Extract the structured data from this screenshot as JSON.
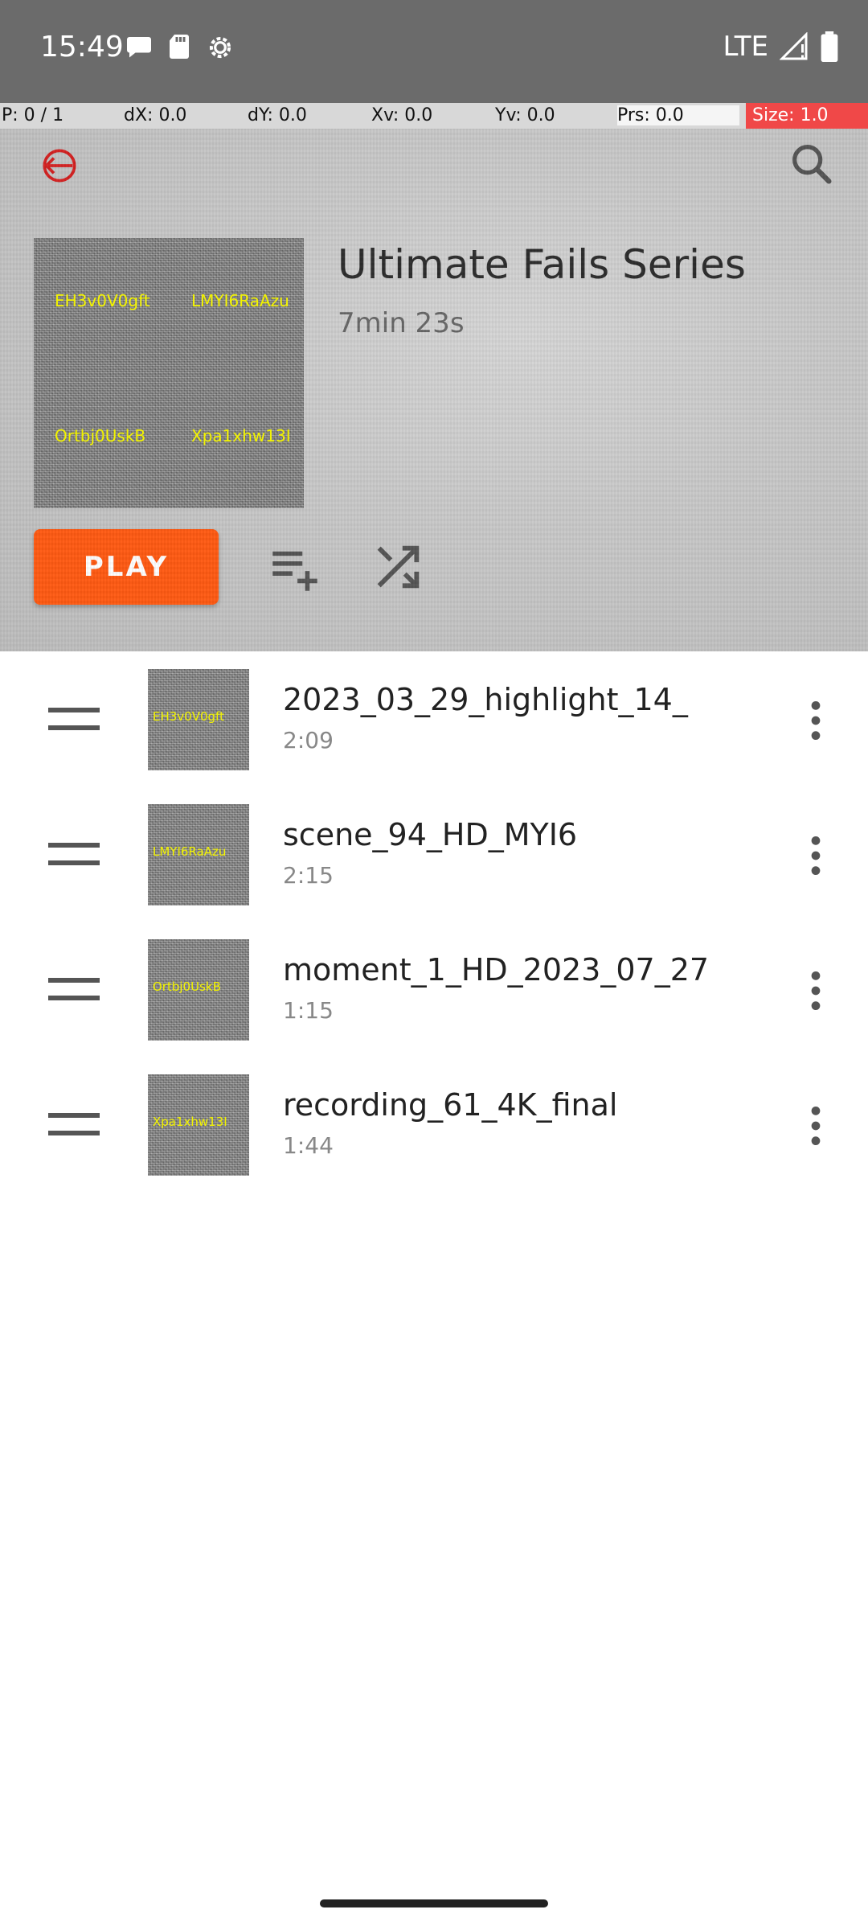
{
  "status_bar": {
    "time": "15:49",
    "network": "LTE"
  },
  "pointer_bar": {
    "p": "P: 0 / 1",
    "dx": "dX: 0.0",
    "dy": "dY: 0.0",
    "xv": "Xv: 0.0",
    "yv": "Yv: 0.0",
    "prs": "Prs: 0.0",
    "size": "Size: 1.0"
  },
  "playlist": {
    "title": "Ultimate Fails Series",
    "duration": "7min 23s",
    "play_label": "PLAY",
    "cover_labels": [
      "EH3v0V0gft",
      "LMYI6RaAzu",
      "Ortbj0UskB",
      "Xpa1xhw13I"
    ]
  },
  "colors": {
    "accent": "#ff5a12",
    "status_bar": "#6b6b6b",
    "header_bg": "#c9c9c9"
  },
  "icons": {
    "back": "back-arrow-icon",
    "search": "search-icon",
    "add_to_queue": "playlist-add-icon",
    "shuffle": "shuffle-icon",
    "drag": "drag-handle-icon",
    "more": "more-vert-icon"
  },
  "tracks": [
    {
      "title": "2023_03_29_highlight_14_",
      "duration": "2:09",
      "thumb_label": "EH3v0V0gft"
    },
    {
      "title": "scene_94_HD_MYI6",
      "duration": "2:15",
      "thumb_label": "LMYI6RaAzu"
    },
    {
      "title": "moment_1_HD_2023_07_27",
      "duration": "1:15",
      "thumb_label": "Ortbj0UskB"
    },
    {
      "title": "recording_61_4K_final",
      "duration": "1:44",
      "thumb_label": "Xpa1xhw13I"
    }
  ]
}
